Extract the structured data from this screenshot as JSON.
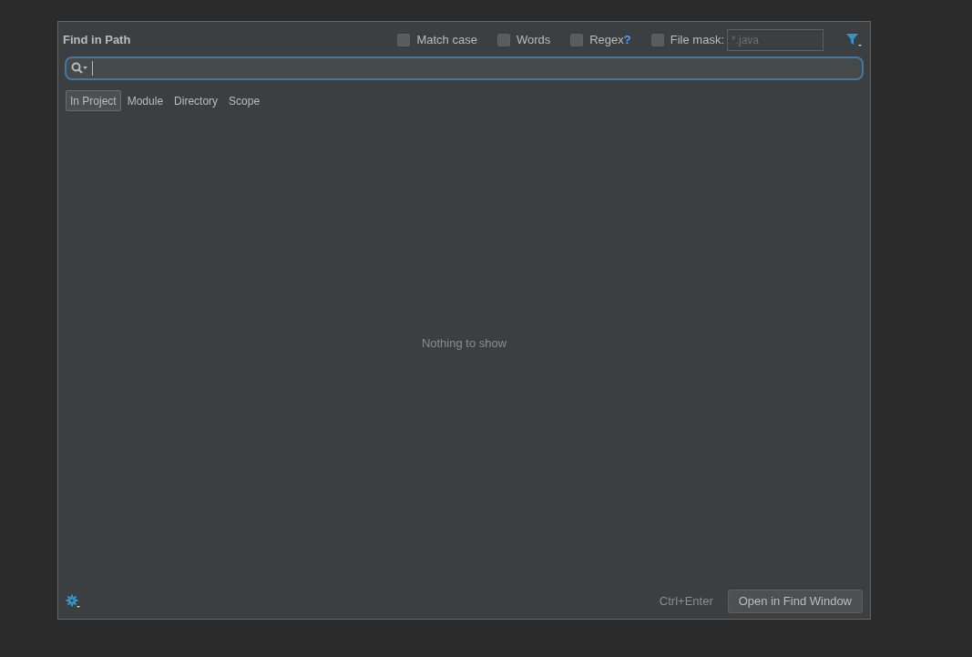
{
  "dialog": {
    "title": "Find in Path"
  },
  "options": [
    {
      "label": "Match case",
      "checked": false
    },
    {
      "label": "Words",
      "checked": false
    },
    {
      "label": "Regex",
      "checked": false,
      "help": "?"
    },
    {
      "label": "File mask:",
      "checked": false,
      "placeholder": "*.java"
    }
  ],
  "scopes": [
    {
      "label": "In Project",
      "selected": true
    },
    {
      "label": "Module",
      "selected": false
    },
    {
      "label": "Directory",
      "selected": false
    },
    {
      "label": "Scope",
      "selected": false
    }
  ],
  "empty_message": "Nothing to show",
  "footer": {
    "shortcut": "Ctrl+Enter",
    "button": "Open in Find Window"
  }
}
